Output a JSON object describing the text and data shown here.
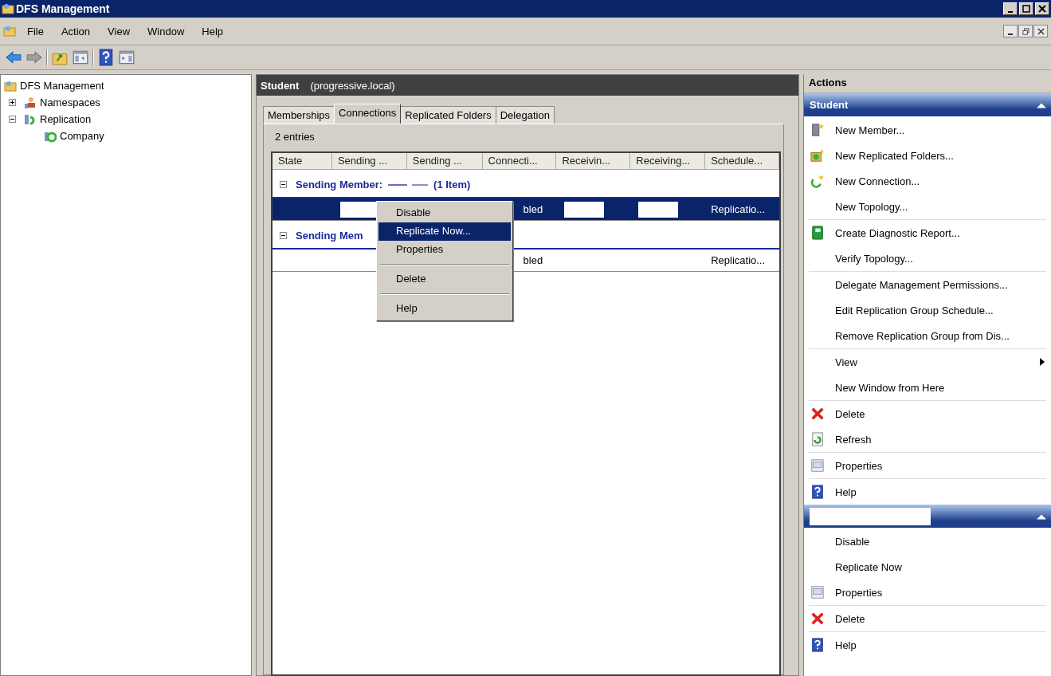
{
  "window": {
    "title": "DFS Management"
  },
  "menu": [
    "File",
    "Action",
    "View",
    "Window",
    "Help"
  ],
  "toolbar": [
    {
      "kind": "back"
    },
    {
      "kind": "forward"
    },
    {
      "kind": "sep"
    },
    {
      "kind": "up"
    },
    {
      "kind": "pane"
    },
    {
      "kind": "sep"
    },
    {
      "kind": "help"
    },
    {
      "kind": "pane2"
    }
  ],
  "tree": {
    "label": "DFS Management",
    "children": [
      {
        "label": "Namespaces",
        "kind": "namespaces",
        "expanded": false
      },
      {
        "label": "Replication",
        "kind": "replication",
        "expanded": true,
        "children": [
          {
            "label": "Company",
            "kind": "group"
          }
        ]
      }
    ]
  },
  "details": {
    "title": "Student",
    "subtitle": "(progressive.local)",
    "tabs": [
      {
        "label": "Memberships",
        "selected": false
      },
      {
        "label": "Connections",
        "selected": true
      },
      {
        "label": "Replicated Folders",
        "selected": false
      },
      {
        "label": "Delegation",
        "selected": false
      }
    ],
    "entries": "2 entries",
    "columns": [
      "State",
      "Sending ...",
      "Sending ...",
      "Connecti...",
      "Receivin...",
      "Receiving...",
      "Schedule..."
    ],
    "groups": [
      {
        "label": "Sending Member:",
        "name_blurred": true,
        "count": "(1 Item)",
        "rows": [
          {
            "selected": true,
            "cells": [
              {
                "kind": "blank"
              },
              {
                "kind": "redacted"
              },
              {
                "kind": "blank"
              },
              {
                "kind": "tail",
                "text": "bled"
              },
              {
                "kind": "redacted"
              },
              {
                "kind": "redacted"
              },
              {
                "kind": "text",
                "text": "Replicatio..."
              }
            ]
          }
        ]
      },
      {
        "label": "Sending Mem",
        "name_blurred": false,
        "rows": [
          {
            "selected": false,
            "cells": [
              {
                "kind": "blank"
              },
              {
                "kind": "blank"
              },
              {
                "kind": "blank"
              },
              {
                "kind": "tail",
                "text": "bled"
              },
              {
                "kind": "blank"
              },
              {
                "kind": "blank"
              },
              {
                "kind": "text",
                "text": "Replicatio..."
              }
            ]
          }
        ]
      }
    ]
  },
  "context_menu": [
    [
      {
        "label": "Disable",
        "selected": false
      },
      {
        "label": "Replicate Now...",
        "selected": true
      },
      {
        "label": "Properties",
        "selected": false
      }
    ],
    [
      {
        "label": "Delete",
        "selected": false
      }
    ],
    [
      {
        "label": "Help",
        "selected": false
      }
    ]
  ],
  "actions": {
    "title": "Actions",
    "sections": [
      {
        "title": "Student",
        "redacted_title": false,
        "groups": [
          [
            {
              "label": "New Member...",
              "kind": "member"
            },
            {
              "label": "New Replicated Folders...",
              "kind": "folders"
            },
            {
              "label": "New Connection...",
              "kind": "connection"
            },
            {
              "label": "New Topology..."
            }
          ],
          [
            {
              "label": "Create Diagnostic Report...",
              "kind": "report"
            },
            {
              "label": "Verify Topology..."
            }
          ],
          [
            {
              "label": "Delegate Management Permissions..."
            },
            {
              "label": "Edit Replication Group Schedule..."
            },
            {
              "label": "Remove Replication Group from Dis..."
            }
          ],
          [
            {
              "label": "View",
              "submenu": true
            },
            {
              "label": "New Window from Here"
            }
          ],
          [
            {
              "label": "Delete",
              "kind": "delete"
            },
            {
              "label": "Refresh",
              "kind": "refresh"
            }
          ],
          [
            {
              "label": "Properties",
              "kind": "properties"
            }
          ],
          [
            {
              "label": "Help",
              "kind": "help"
            }
          ]
        ]
      },
      {
        "redacted_title": true,
        "groups": [
          [
            {
              "label": "Disable"
            },
            {
              "label": "Replicate Now"
            },
            {
              "label": "Properties",
              "kind": "properties"
            }
          ],
          [
            {
              "label": "Delete",
              "kind": "delete"
            }
          ],
          [
            {
              "label": "Help",
              "kind": "help"
            }
          ]
        ]
      }
    ]
  }
}
